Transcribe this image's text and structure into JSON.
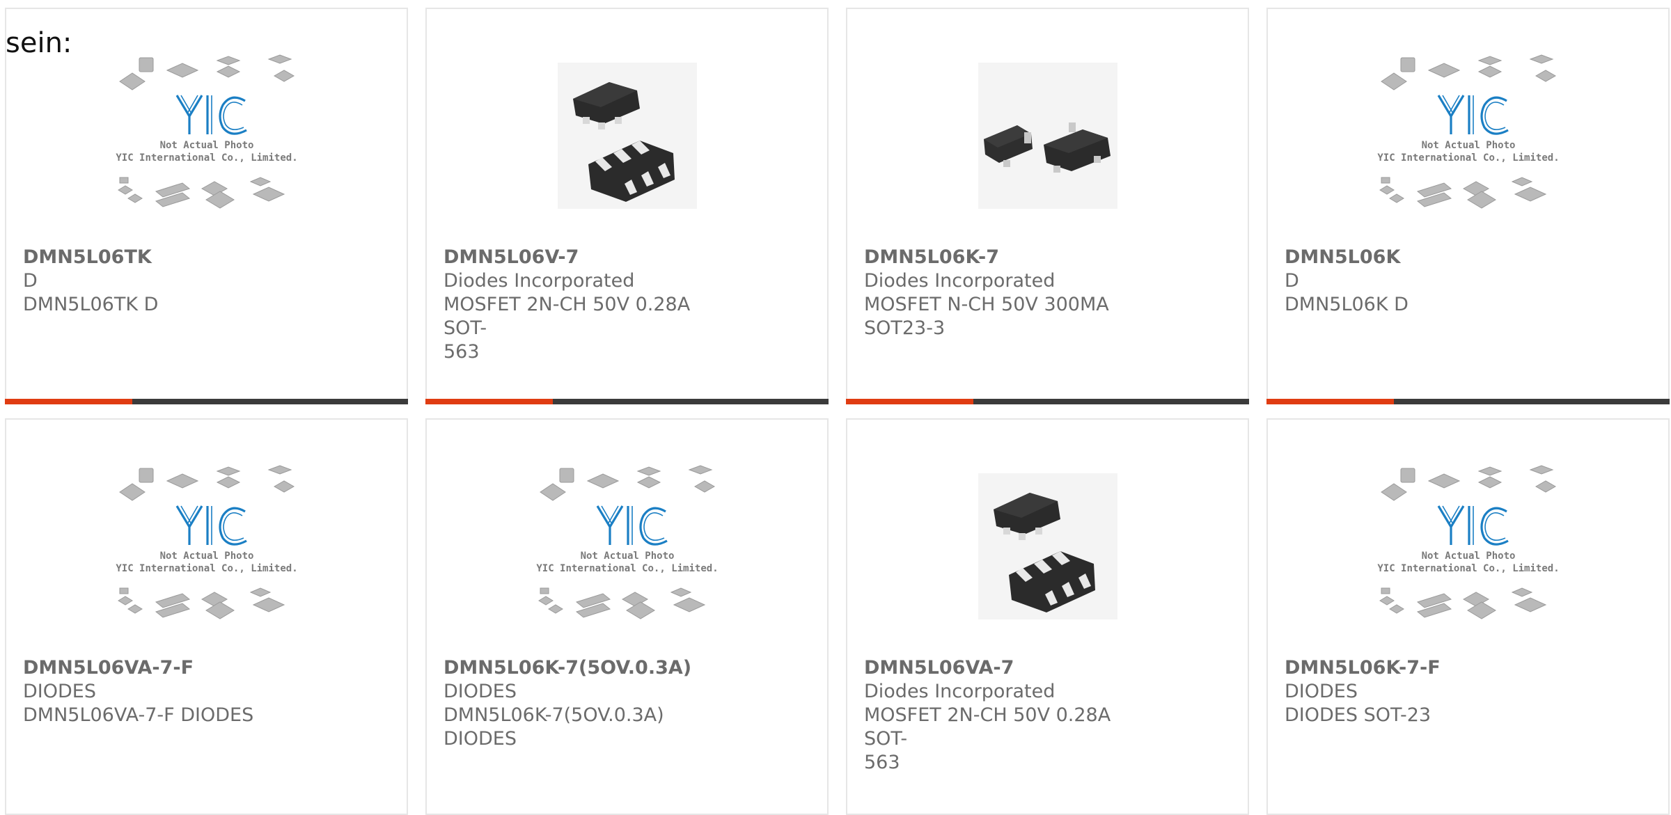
{
  "heading": "sein:",
  "placeholder": {
    "line1": "Not Actual Photo",
    "line2": "YIC International Co., Limited.",
    "logo": "YIC"
  },
  "colors": {
    "accent": "#e03c12",
    "bar": "#3b3b3b",
    "logo": "#1b7fc4",
    "text": "#6b6b6b"
  },
  "cards": [
    {
      "part": "DMN5L06TK",
      "manufacturer": "D",
      "desc1": "DMN5L06TK D",
      "desc2": "",
      "image": "placeholder"
    },
    {
      "part": "DMN5L06V-7",
      "manufacturer": "Diodes Incorporated",
      "desc1": "MOSFET 2N-CH 50V 0.28A SOT-",
      "desc2": "563",
      "image": "sot563-photo"
    },
    {
      "part": "DMN5L06K-7",
      "manufacturer": "Diodes Incorporated",
      "desc1": "MOSFET N-CH 50V 300MA",
      "desc2": "SOT23-3",
      "image": "sot23-photo"
    },
    {
      "part": "DMN5L06K",
      "manufacturer": "D",
      "desc1": "DMN5L06K D",
      "desc2": "",
      "image": "placeholder"
    },
    {
      "part": "DMN5L06VA-7-F",
      "manufacturer": "DIODES",
      "desc1": "DMN5L06VA-7-F DIODES",
      "desc2": "",
      "image": "placeholder"
    },
    {
      "part": "DMN5L06K-7(5OV.0.3A)",
      "manufacturer": "DIODES",
      "desc1": "DMN5L06K-7(5OV.0.3A) DIODES",
      "desc2": "",
      "image": "placeholder"
    },
    {
      "part": "DMN5L06VA-7",
      "manufacturer": "Diodes Incorporated",
      "desc1": "MOSFET 2N-CH 50V 0.28A SOT-",
      "desc2": "563",
      "image": "sot563-photo"
    },
    {
      "part": "DMN5L06K-7-F",
      "manufacturer": "DIODES",
      "desc1": "DIODES SOT-23",
      "desc2": "",
      "image": "placeholder"
    }
  ]
}
